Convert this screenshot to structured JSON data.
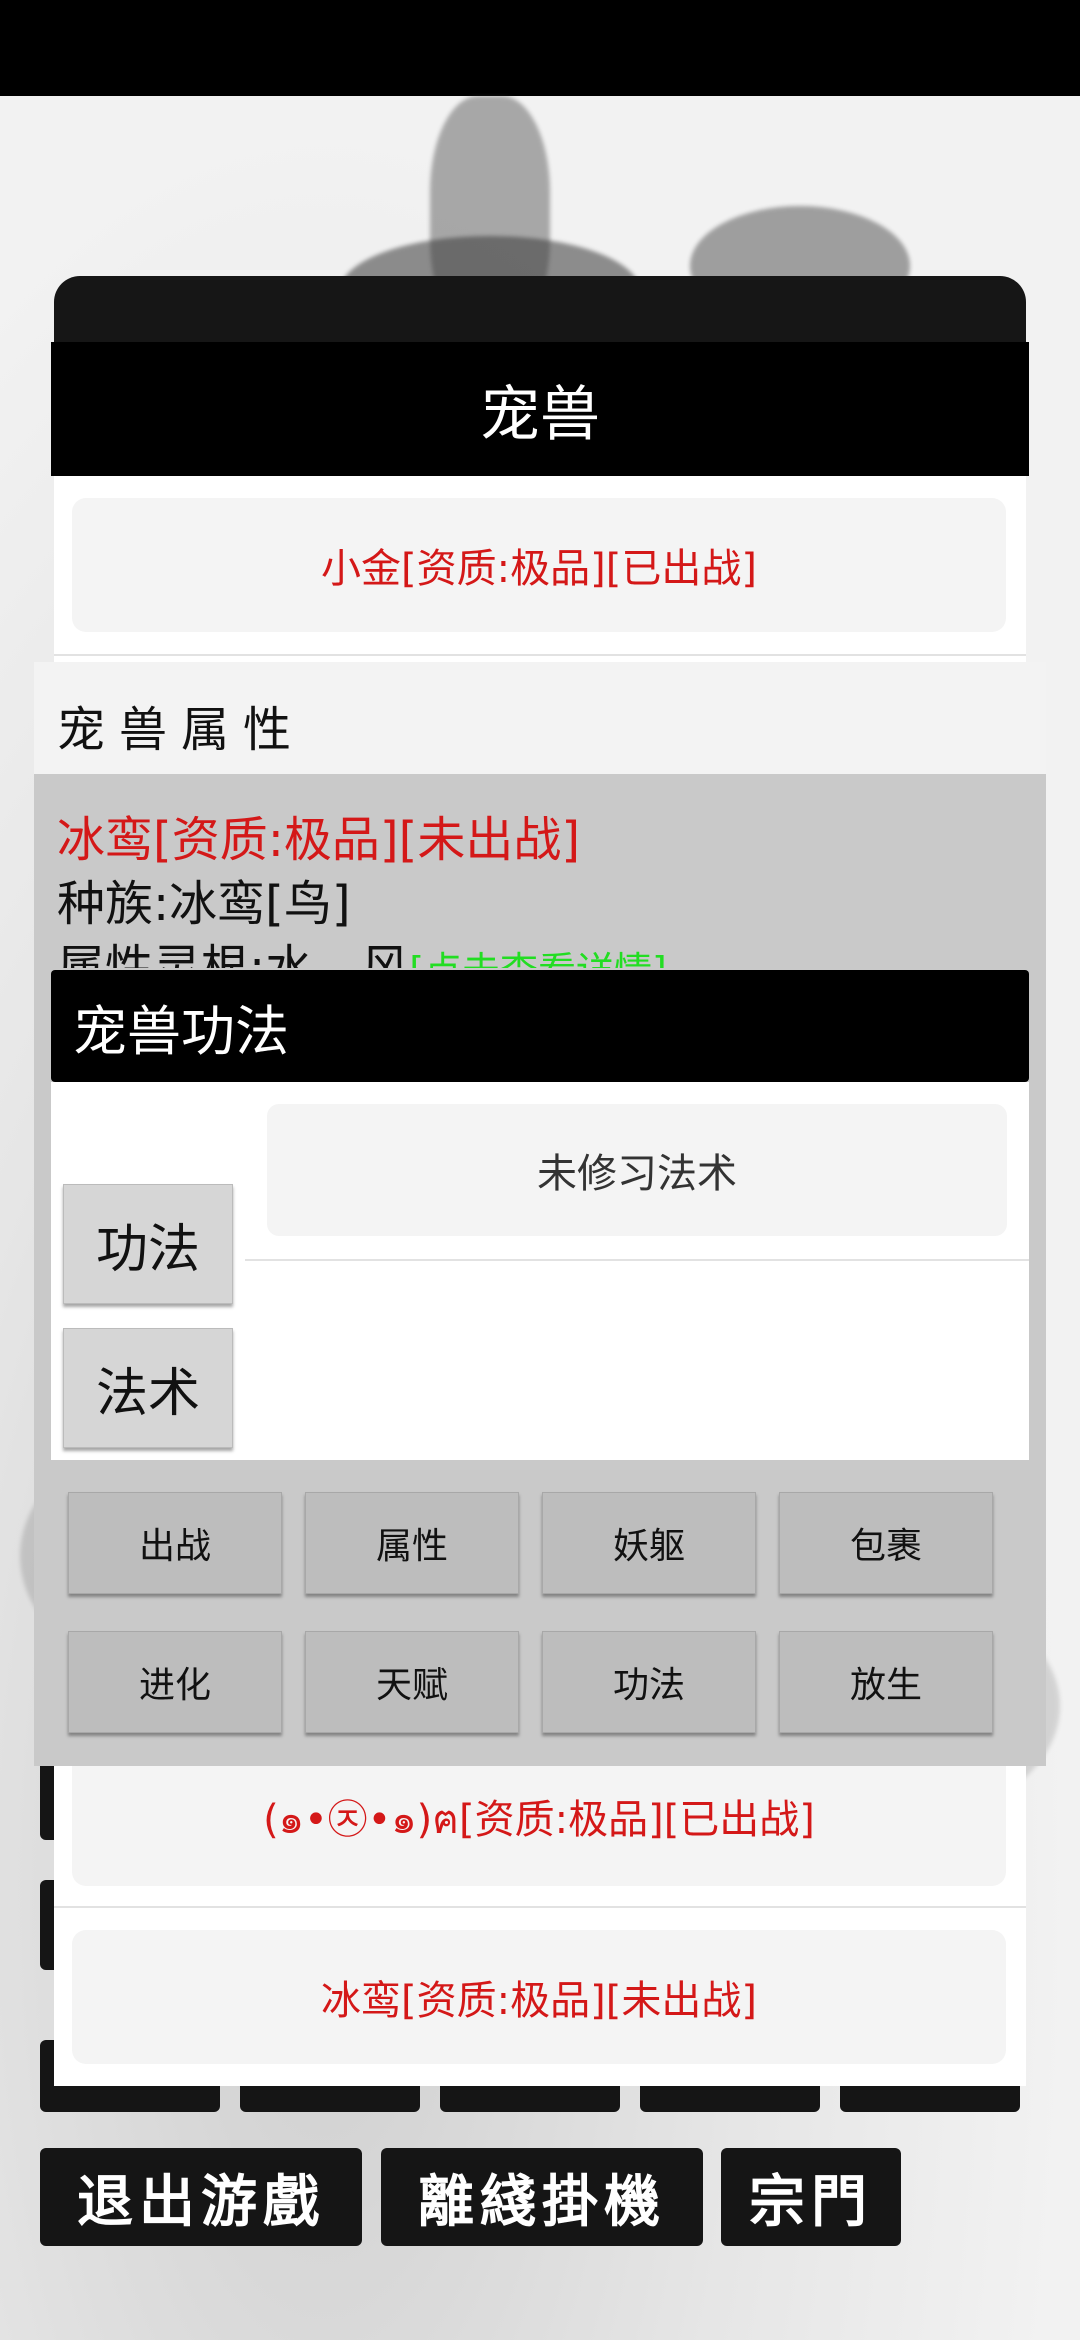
{
  "dialog": {
    "title": "宠兽"
  },
  "pet_list": [
    "小金[资质:极品][已出战]",
    "(๑•㉨•๑)ฅ[资质:极品][已出战]",
    "冰鸾[资质:极品][未出战]"
  ],
  "attributes": {
    "title": "宠兽属性",
    "name_line": "冰鸾[资质:极品][未出战]",
    "race_line": "种族:冰鸾[鸟]",
    "spirit_root_label": "属性灵根:水、风",
    "spirit_root_link": "[点击查看详情]"
  },
  "skills": {
    "title": "宠兽功法",
    "tabs": [
      "功法",
      "法术"
    ],
    "empty_text": "未修习法术"
  },
  "actions": {
    "row1": [
      "出战",
      "属性",
      "妖躯",
      "包裹"
    ],
    "row2": [
      "进化",
      "天赋",
      "功法",
      "放生"
    ]
  },
  "bottom_menu": [
    "退出游戲",
    "離綫掛機",
    "宗門"
  ],
  "colors": {
    "accent_red": "#d41818",
    "link_green": "#22dd22"
  }
}
